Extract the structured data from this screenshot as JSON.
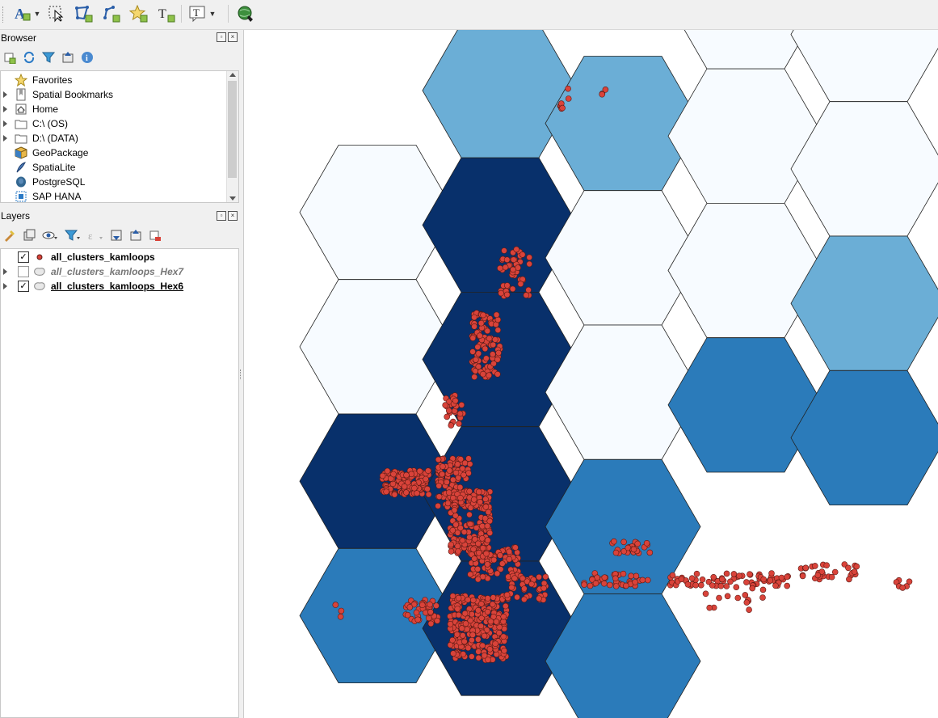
{
  "toolbar": {
    "tools": [
      {
        "name": "label-tool",
        "glyph": "A"
      },
      {
        "name": "select-tool",
        "glyph": ""
      },
      {
        "name": "add-polygon-tool",
        "glyph": ""
      },
      {
        "name": "add-line-tool",
        "glyph": ""
      },
      {
        "name": "add-point-tool",
        "glyph": "★"
      },
      {
        "name": "text-annotation-tool",
        "glyph": "T"
      },
      {
        "name": "text-tool",
        "glyph": "T"
      },
      {
        "name": "globe-plugin",
        "glyph": ""
      }
    ]
  },
  "browser": {
    "title": "Browser",
    "items": [
      {
        "label": "Favorites",
        "icon": "star-icon",
        "expandable": false
      },
      {
        "label": "Spatial Bookmarks",
        "icon": "bookmark-icon",
        "expandable": true
      },
      {
        "label": "Home",
        "icon": "home-icon",
        "expandable": true
      },
      {
        "label": "C:\\ (OS)",
        "icon": "folder-icon",
        "expandable": true
      },
      {
        "label": "D:\\ (DATA)",
        "icon": "folder-icon",
        "expandable": true
      },
      {
        "label": "GeoPackage",
        "icon": "geopackage-icon",
        "expandable": false
      },
      {
        "label": "SpatiaLite",
        "icon": "spatialite-icon",
        "expandable": false
      },
      {
        "label": "PostgreSQL",
        "icon": "postgresql-icon",
        "expandable": false
      },
      {
        "label": "SAP HANA",
        "icon": "hana-icon",
        "expandable": false
      }
    ]
  },
  "layers": {
    "title": "Layers",
    "items": [
      {
        "label": "all_clusters_kamloops",
        "checked": true,
        "style": "bold",
        "expandable": false,
        "icon": "point-layer-icon"
      },
      {
        "label": "all_clusters_kamloops_Hex7",
        "checked": false,
        "style": "italic",
        "expandable": true,
        "icon": "polygon-layer-icon"
      },
      {
        "label": "all_clusters_kamloops_Hex6",
        "checked": true,
        "style": "bold-underline",
        "expandable": true,
        "icon": "polygon-layer-icon"
      }
    ]
  },
  "map": {
    "colors": {
      "class0": "#f7fbff",
      "class1": "#6baed6",
      "class2": "#2b7bba",
      "class3": "#08306b",
      "point": "#d9433a",
      "point_stroke": "#5a1a14"
    }
  }
}
